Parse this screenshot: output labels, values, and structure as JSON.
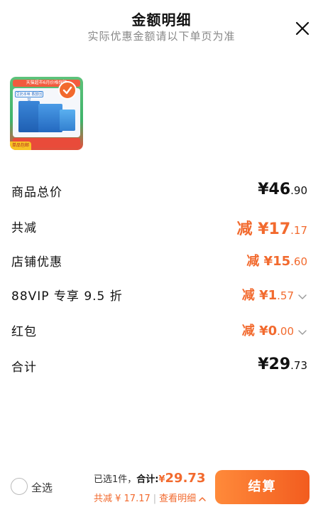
{
  "header": {
    "title": "金额明细",
    "subtitle": "实际优惠金额请以下单页为准"
  },
  "product": {
    "top_banner": "天猫超市6月价格保障",
    "box_tag": "豆奶本味 香醇回甘",
    "badge": "单品包邮",
    "bottom_text": "官方自营 售后无忧"
  },
  "rows": [
    {
      "label": "商品总价",
      "prefix": "",
      "symbol": "¥",
      "integer": "46",
      "decimal": ".90",
      "color": "#111111"
    },
    {
      "label": "共减",
      "prefix": "减 ",
      "symbol": "¥",
      "integer": "17",
      "decimal": ".17",
      "color": "#f26a2e"
    },
    {
      "label": "店铺优惠",
      "prefix": "减 ",
      "symbol": "¥",
      "integer": "15",
      "decimal": ".60",
      "color": "#f26a2e"
    },
    {
      "label": "88VIP 专享 9.5 折",
      "prefix": "减 ",
      "symbol": "¥",
      "integer": "1",
      "decimal": ".57",
      "color": "#f26a2e"
    },
    {
      "label": "红包",
      "prefix": "减 ",
      "symbol": "¥",
      "integer": "0",
      "decimal": ".00",
      "color": "#f26a2e"
    },
    {
      "label": "合计",
      "prefix": "",
      "symbol": "¥",
      "integer": "29",
      "decimal": ".73",
      "color": "#111111"
    }
  ],
  "footer": {
    "select_all": "全选",
    "selected_text": "已选1件，",
    "total_label": "合计:",
    "total_symbol": "¥",
    "total_amount": "29.73",
    "discount_text": "共减 ¥ 17.17",
    "detail_link": "查看明细",
    "checkout_label": "结算"
  },
  "colors": {
    "accent": "#f26a2e",
    "text": "#111111",
    "muted": "#888888"
  }
}
